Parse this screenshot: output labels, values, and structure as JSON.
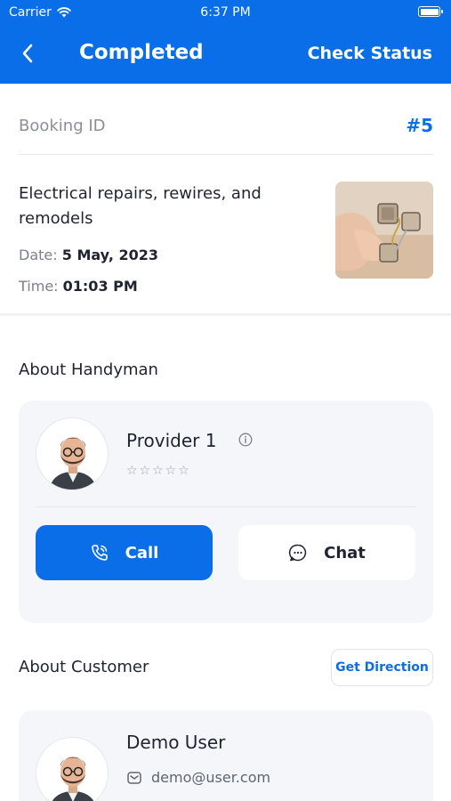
{
  "status_bar": {
    "carrier": "Carrier",
    "time": "6:37 PM"
  },
  "header": {
    "title": "Completed",
    "action": "Check Status",
    "background": "#0a6ee8"
  },
  "booking": {
    "id_label": "Booking ID",
    "id_value": "#5",
    "service_name": "Electrical repairs, rewires, and remodels",
    "date_label": "Date:",
    "date_value": "5 May, 2023",
    "time_label": "Time:",
    "time_value": "01:03 PM"
  },
  "handyman": {
    "section_title": "About Handyman",
    "name": "Provider 1",
    "rating": 0,
    "stars": "☆☆☆☆☆",
    "call_label": "Call",
    "chat_label": "Chat"
  },
  "customer": {
    "section_title": "About Customer",
    "direction_label": "Get Direction",
    "name": "Demo User",
    "email": "demo@user.com"
  },
  "colors": {
    "accent": "#0a6ee8",
    "card": "#f4f6f9",
    "muted": "#8a8f99"
  }
}
